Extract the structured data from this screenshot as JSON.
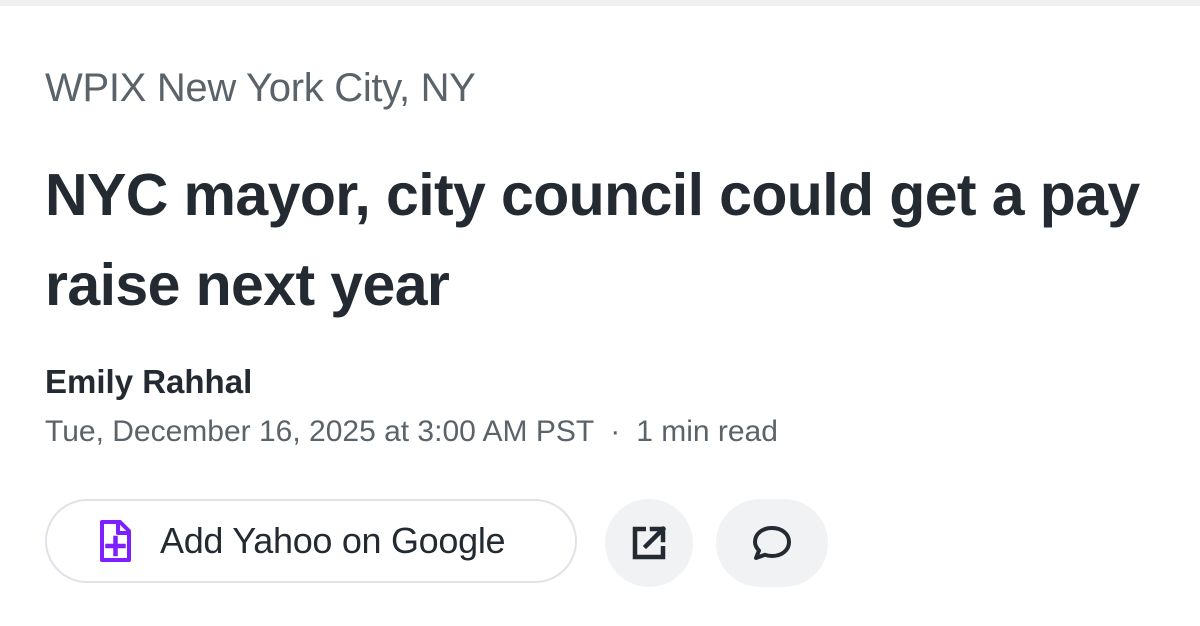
{
  "article": {
    "source": "WPIX New York City, NY",
    "headline": "NYC mayor, city council could get a pay raise next year",
    "author": "Emily Rahhal",
    "date": "Tue, December 16, 2025 at 3:00 AM PST",
    "separator": "·",
    "read_time": "1 min read"
  },
  "actions": {
    "add_yahoo_label": "Add Yahoo on Google",
    "add_yahoo_icon": "document-plus-icon",
    "share_icon": "external-link-icon",
    "comment_icon": "comment-bubble-icon"
  },
  "colors": {
    "accent": "#7e1fff",
    "headline": "#232a31",
    "secondary_text": "#5b636a"
  }
}
